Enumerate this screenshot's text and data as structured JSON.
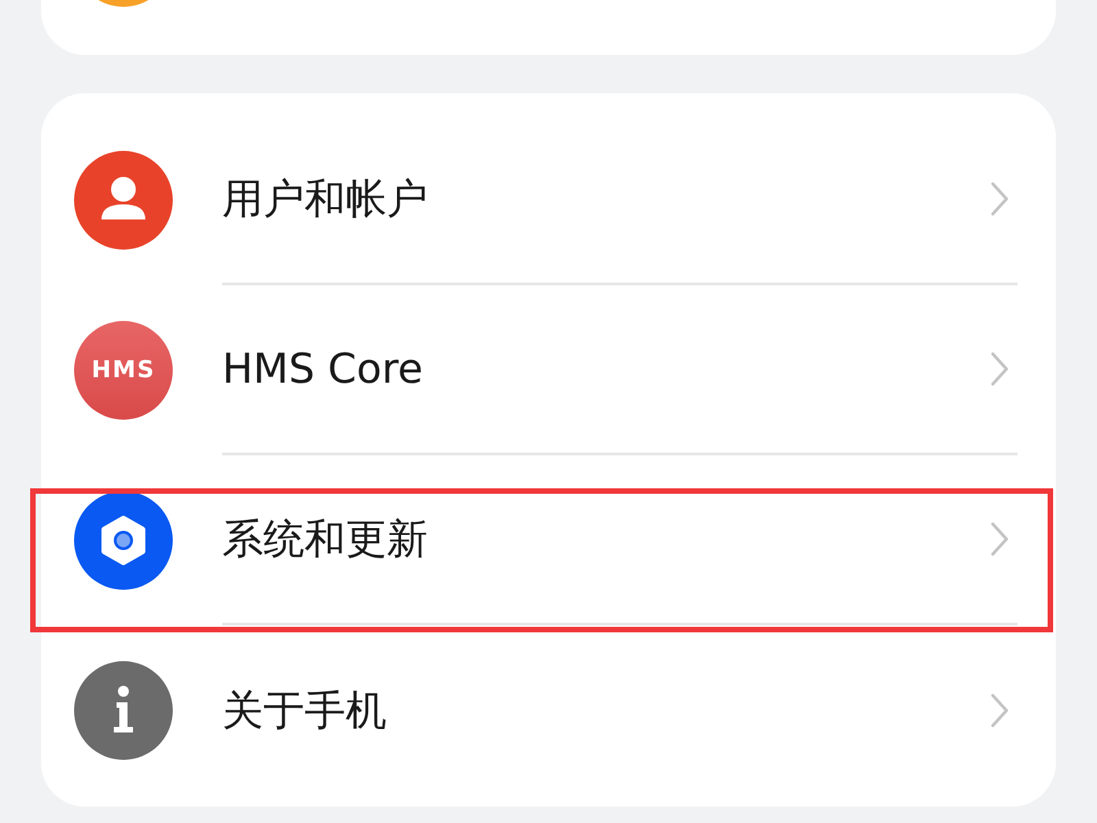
{
  "top_card": {
    "icon": {
      "kind": "orange"
    }
  },
  "settings": [
    {
      "label": "用户和帐户",
      "icon": {
        "kind": "person"
      },
      "highlighted": false
    },
    {
      "label": "HMS Core",
      "icon": {
        "kind": "badge",
        "text": "HMS"
      },
      "highlighted": false
    },
    {
      "label": "系统和更新",
      "icon": {
        "kind": "gear"
      },
      "highlighted": true
    },
    {
      "label": "关于手机",
      "icon": {
        "kind": "info"
      },
      "highlighted": false
    }
  ]
}
